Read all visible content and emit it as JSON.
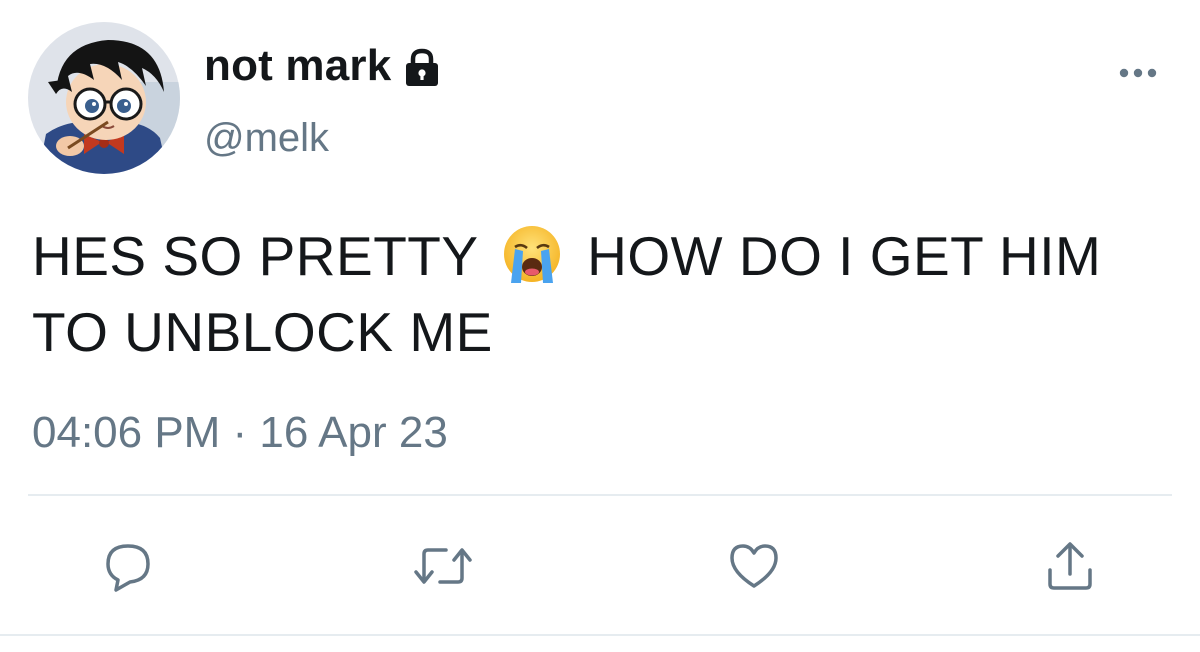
{
  "tweet": {
    "display_name": "not mark",
    "handle": "@melk",
    "protected_icon": "lock-icon",
    "text_line1_before": "HES SO PRETTY",
    "emoji": "loudly-crying-face",
    "text_line1_after": "HOW DO I GET HIM",
    "text_line2": "TO UNBLOCK ME",
    "timestamp": "04:06 PM · 16 Apr 23"
  },
  "actions": [
    {
      "name": "reply",
      "icon": "reply-icon"
    },
    {
      "name": "retweet",
      "icon": "retweet-icon"
    },
    {
      "name": "like",
      "icon": "heart-icon"
    },
    {
      "name": "share",
      "icon": "share-icon"
    }
  ],
  "colors": {
    "text": "#14171a",
    "secondary": "#657786",
    "divider": "#e6ecf0"
  }
}
